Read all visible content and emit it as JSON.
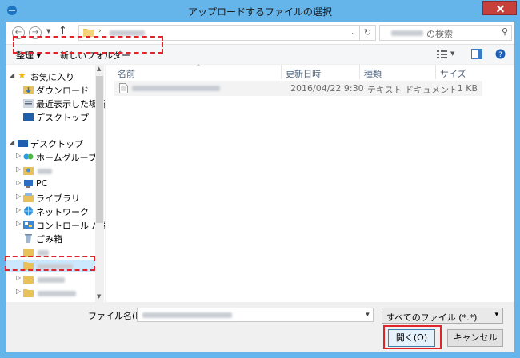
{
  "window": {
    "title": "アップロードするファイルの選択"
  },
  "address": {
    "search_suffix": "の検索"
  },
  "toolbar": {
    "organize": "整理 ▾",
    "new_folder": "新しいフォルダー"
  },
  "nav": {
    "favorites": "お気に入り",
    "downloads": "ダウンロード",
    "recent": "最近表示した場所",
    "desktop_fav": "デスクトップ",
    "desktop": "デスクトップ",
    "homegroup": "ホームグループ",
    "pc": "PC",
    "libraries": "ライブラリ",
    "network": "ネットワーク",
    "control_panel": "コントロール パネル",
    "recycle": "ごみ箱"
  },
  "columns": {
    "name": "名前",
    "date": "更新日時",
    "type": "種類",
    "size": "サイズ"
  },
  "file": {
    "date": "2016/04/22 9:30",
    "type": "テキスト ドキュメント",
    "size": "1 KB"
  },
  "bottom": {
    "filename_label": "ファイル名(N):",
    "filter": "すべてのファイル (*.*)",
    "open": "開く(O)",
    "cancel": "キャンセル"
  }
}
